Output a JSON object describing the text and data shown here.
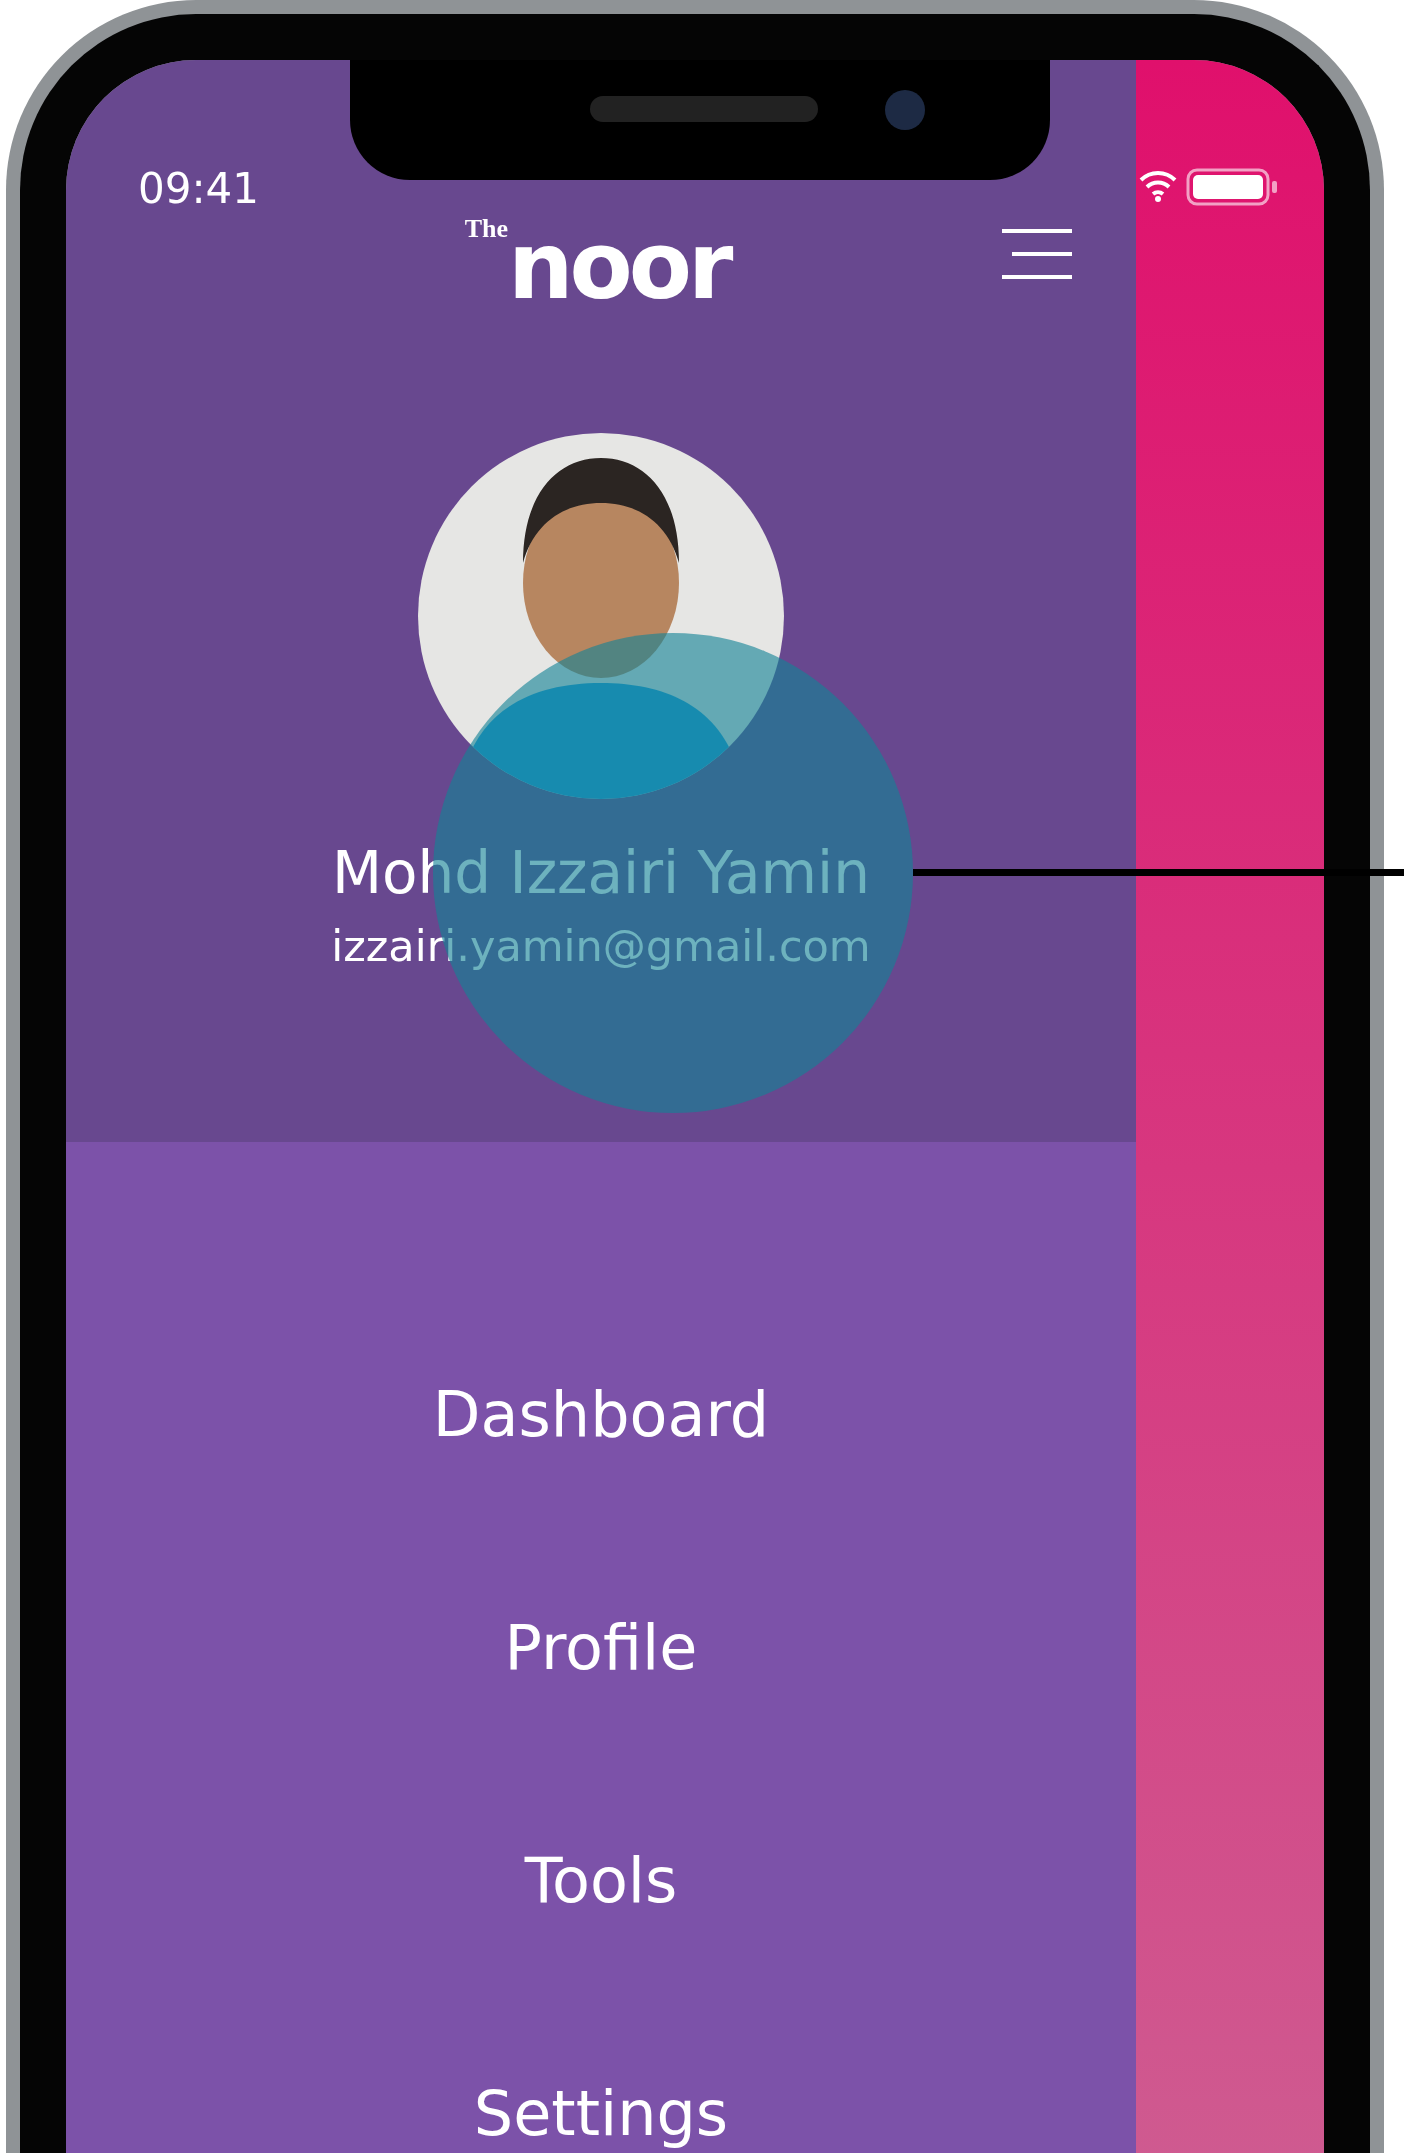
{
  "status_bar": {
    "time": "09:41"
  },
  "logo": {
    "prefix": "The",
    "name": "noor"
  },
  "profile": {
    "name": "Mohd Izzairi Yamin",
    "email": "izzairi.yamin@gmail.com"
  },
  "menu": [
    {
      "label": "Dashboard"
    },
    {
      "label": "Profile"
    },
    {
      "label": "Tools"
    },
    {
      "label": "Settings"
    }
  ]
}
